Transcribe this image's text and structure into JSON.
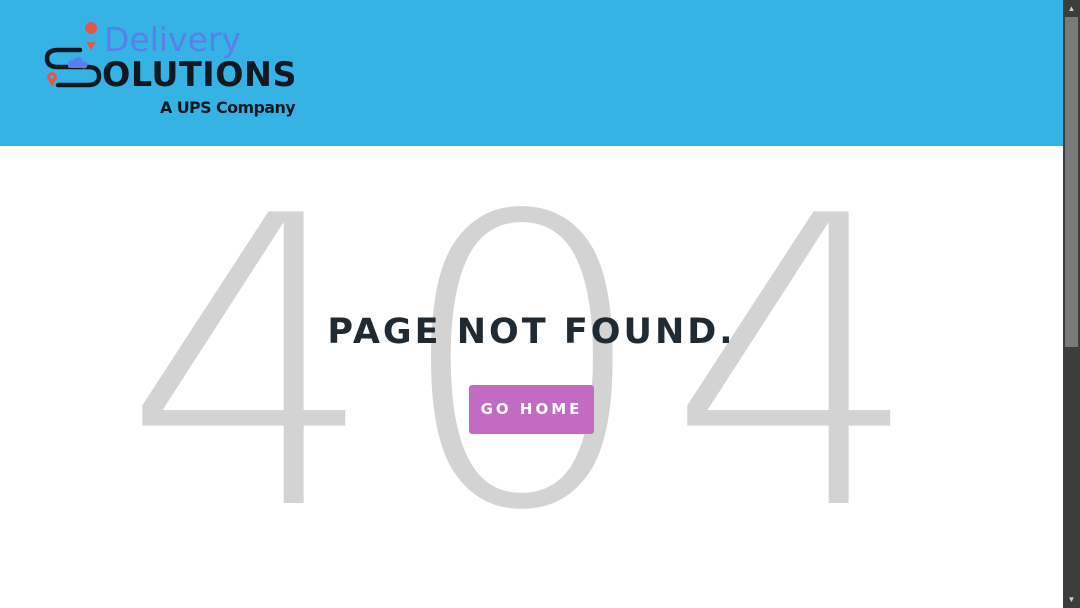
{
  "header": {
    "logo": {
      "word_top": "Delivery",
      "word_main": "SOLUTIONS",
      "tagline": "A UPS Company",
      "colors": {
        "delivery": "#5b7fe8",
        "solutions": "#101820",
        "pin": "#e2574c",
        "cloud": "#5b7fe8"
      }
    },
    "background": "#36b3e5"
  },
  "error": {
    "code": "404",
    "message": "PAGE NOT FOUND.",
    "button_label": "GO HOME",
    "button_color": "#c36ac4"
  },
  "scrollbar": {
    "up_arrow": "▲",
    "down_arrow": "▼"
  }
}
